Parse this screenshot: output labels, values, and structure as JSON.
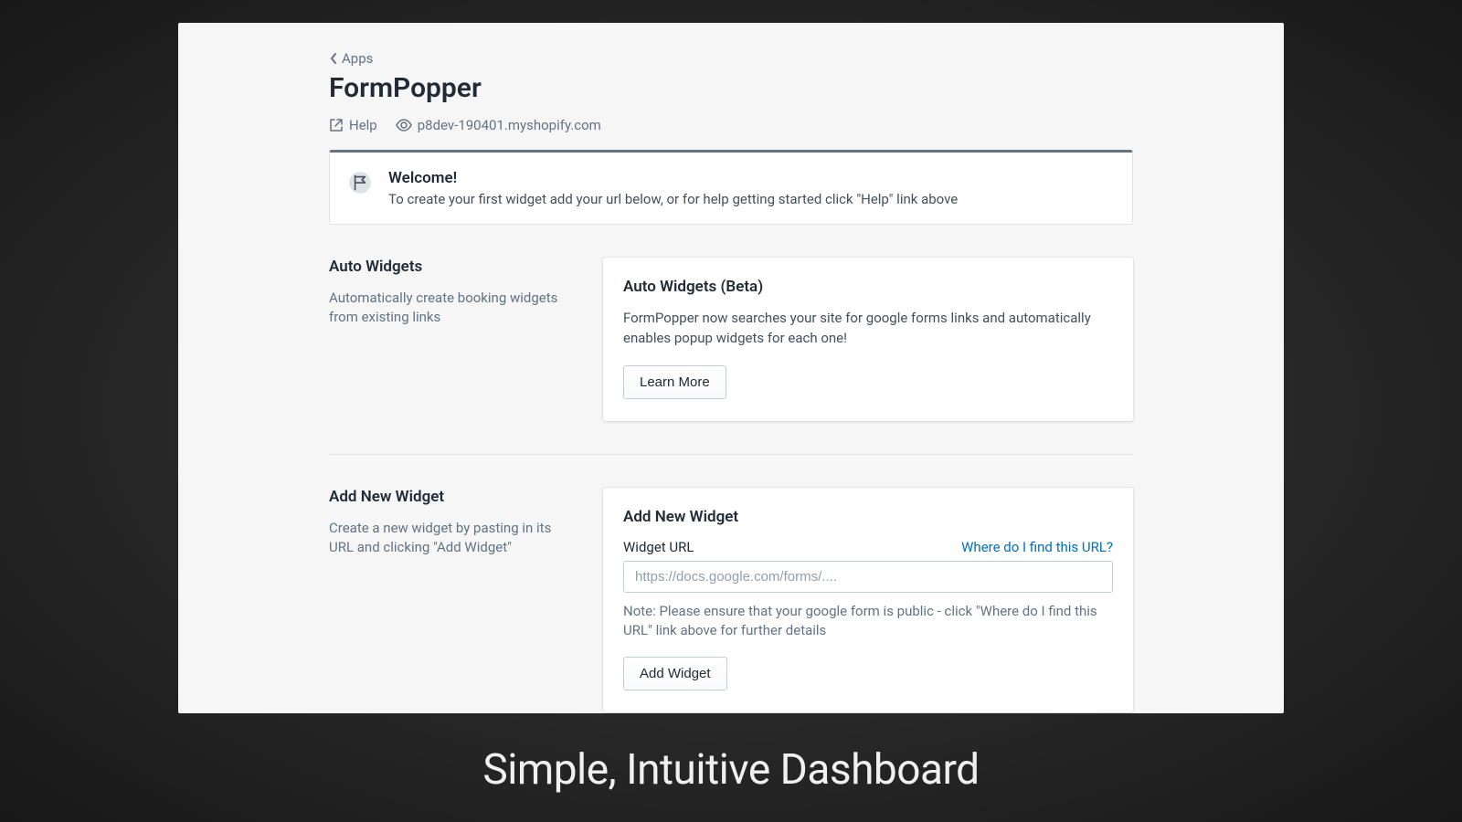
{
  "breadcrumb": {
    "label": "Apps"
  },
  "page": {
    "title": "FormPopper"
  },
  "header_links": {
    "help": "Help",
    "shop_domain": "p8dev-190401.myshopify.com"
  },
  "banner": {
    "title": "Welcome!",
    "description": "To create your first widget add your url below, or for help getting started click \"Help\" link above"
  },
  "sections": {
    "auto_widgets": {
      "left_heading": "Auto Widgets",
      "left_subtext": "Automatically create booking widgets from existing links",
      "card_title": "Auto Widgets (Beta)",
      "card_desc": "FormPopper now searches your site for google forms links and automatically enables popup widgets for each one!",
      "learn_more_label": "Learn More"
    },
    "add_widget": {
      "left_heading": "Add New Widget",
      "left_subtext": "Create a new widget by pasting in its URL and clicking \"Add Widget\"",
      "card_title": "Add New Widget",
      "url_label": "Widget URL",
      "url_help_link": "Where do I find this URL?",
      "url_placeholder": "https://docs.google.com/forms/....",
      "url_note": "Note: Please ensure that your google form is public - click \"Where do I find this URL\" link above for further details",
      "add_button_label": "Add Widget"
    }
  },
  "caption": "Simple, Intuitive Dashboard"
}
